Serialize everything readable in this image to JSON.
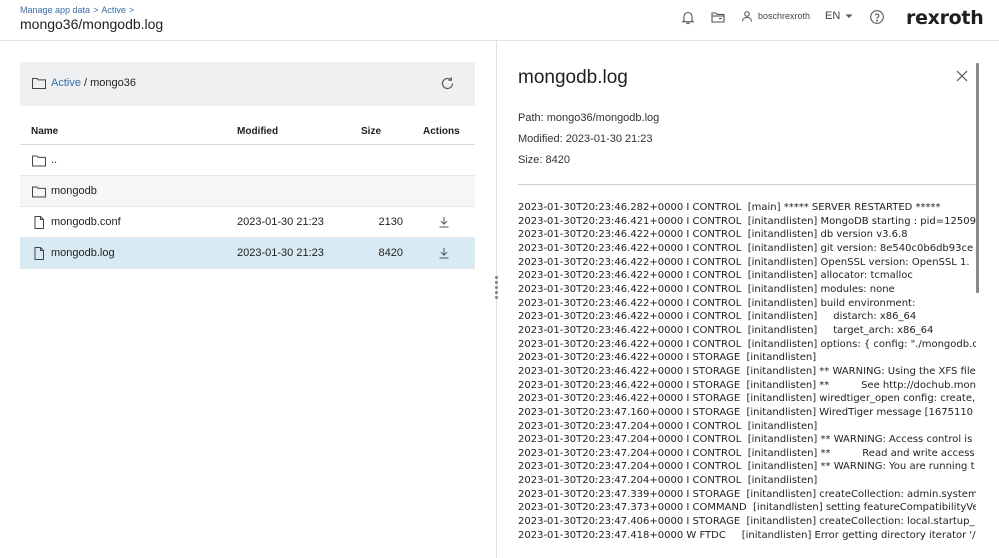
{
  "header": {
    "breadcrumb": [
      "Manage app data",
      "Active"
    ],
    "breadcrumb_sep": ">",
    "title": "mongo36/mongodb.log",
    "user": "boschrexroth",
    "language": "EN",
    "logo": "rexroth",
    "icons": [
      "bell-icon",
      "folder-open-icon",
      "user-icon",
      "chevron-down-icon",
      "help-icon"
    ]
  },
  "left": {
    "folder_bar": {
      "link": "Active",
      "sep": " / ",
      "current": "mongo36"
    },
    "columns": [
      "Name",
      "Modified",
      "Size",
      "Actions"
    ],
    "rows": [
      {
        "type": "folder",
        "name": "..",
        "modified": "",
        "size": ""
      },
      {
        "type": "folder",
        "name": "mongodb",
        "modified": "",
        "size": ""
      },
      {
        "type": "file",
        "name": "mongodb.conf",
        "modified": "2023-01-30 21:23",
        "size": "2130"
      },
      {
        "type": "file",
        "name": "mongodb.log",
        "modified": "2023-01-30 21:23",
        "size": "8420"
      }
    ]
  },
  "right": {
    "title": "mongodb.log",
    "path": "Path: mongo36/mongodb.log",
    "modified": "Modified: 2023-01-30 21:23",
    "size": "Size: 8420",
    "log_lines": [
      "2023-01-30T20:23:46.282+0000 I CONTROL  [main] ***** SERVER RESTARTED *****",
      "2023-01-30T20:23:46.421+0000 I CONTROL  [initandlisten] MongoDB starting : pid=12509",
      "2023-01-30T20:23:46.422+0000 I CONTROL  [initandlisten] db version v3.6.8",
      "2023-01-30T20:23:46.422+0000 I CONTROL  [initandlisten] git version: 8e540c0b6db93ce",
      "2023-01-30T20:23:46.422+0000 I CONTROL  [initandlisten] OpenSSL version: OpenSSL 1.",
      "2023-01-30T20:23:46.422+0000 I CONTROL  [initandlisten] allocator: tcmalloc",
      "2023-01-30T20:23:46.422+0000 I CONTROL  [initandlisten] modules: none",
      "2023-01-30T20:23:46.422+0000 I CONTROL  [initandlisten] build environment:",
      "2023-01-30T20:23:46.422+0000 I CONTROL  [initandlisten]     distarch: x86_64",
      "2023-01-30T20:23:46.422+0000 I CONTROL  [initandlisten]     target_arch: x86_64",
      "2023-01-30T20:23:46.422+0000 I CONTROL  [initandlisten] options: { config: \"./mongodb.c",
      "2023-01-30T20:23:46.422+0000 I STORAGE  [initandlisten]",
      "2023-01-30T20:23:46.422+0000 I STORAGE  [initandlisten] ** WARNING: Using the XFS file",
      "2023-01-30T20:23:46.422+0000 I STORAGE  [initandlisten] **          See http://dochub.mon",
      "2023-01-30T20:23:46.422+0000 I STORAGE  [initandlisten] wiredtiger_open config: create,",
      "2023-01-30T20:23:47.160+0000 I STORAGE  [initandlisten] WiredTiger message [1675110",
      "2023-01-30T20:23:47.204+0000 I CONTROL  [initandlisten]",
      "2023-01-30T20:23:47.204+0000 I CONTROL  [initandlisten] ** WARNING: Access control is",
      "2023-01-30T20:23:47.204+0000 I CONTROL  [initandlisten] **          Read and write access",
      "2023-01-30T20:23:47.204+0000 I CONTROL  [initandlisten] ** WARNING: You are running t",
      "2023-01-30T20:23:47.204+0000 I CONTROL  [initandlisten]",
      "2023-01-30T20:23:47.339+0000 I STORAGE  [initandlisten] createCollection: admin.system",
      "2023-01-30T20:23:47.373+0000 I COMMAND  [initandlisten] setting featureCompatibilityVe",
      "2023-01-30T20:23:47.406+0000 I STORAGE  [initandlisten] createCollection: local.startup_",
      "2023-01-30T20:23:47.418+0000 W FTDC     [initandlisten] Error getting directory iterator '/"
    ]
  }
}
